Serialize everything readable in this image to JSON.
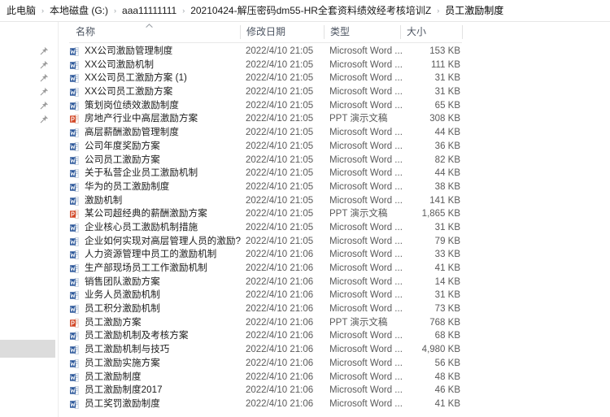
{
  "window": {
    "type": "file-explorer"
  },
  "breadcrumb": {
    "separator": "›",
    "items": [
      {
        "label": "此电脑"
      },
      {
        "label": "本地磁盘 (G:)"
      },
      {
        "label": "aaa11111111"
      },
      {
        "label": "20210424-解压密码dm55-HR全套资料绩效经考核培训Z"
      },
      {
        "label": "员工激励制度"
      }
    ]
  },
  "columns": {
    "name": "名称",
    "date_modified": "修改日期",
    "type": "类型",
    "size": "大小",
    "sort_column": "名称",
    "sort_direction": "ascending",
    "sort_icon": "chevron-up-icon"
  },
  "icons": {
    "word": "word-document-icon",
    "powerpoint": "powerpoint-document-icon",
    "pin": "pin-icon"
  },
  "types": {
    "word": "Microsoft Word ...",
    "powerpoint": "PPT 演示文稿"
  },
  "colors": {
    "word_blue": "#2b579a",
    "ppt_orange": "#d24726",
    "text": "#1b1b1b",
    "secondary_text": "#5a5a5a",
    "header_text": "#4d5562",
    "divider": "#e6e6e6"
  },
  "files": [
    {
      "name": "XX公司激励管理制度",
      "date": "2022/4/10 21:05",
      "type": "Microsoft Word ...",
      "size": "153 KB",
      "icon": "word",
      "pinned": true
    },
    {
      "name": "XX公司激励机制",
      "date": "2022/4/10 21:05",
      "type": "Microsoft Word ...",
      "size": "111 KB",
      "icon": "word",
      "pinned": true
    },
    {
      "name": "XX公司员工激励方案 (1)",
      "date": "2022/4/10 21:05",
      "type": "Microsoft Word ...",
      "size": "31 KB",
      "icon": "word",
      "pinned": true
    },
    {
      "name": "XX公司员工激励方案",
      "date": "2022/4/10 21:05",
      "type": "Microsoft Word ...",
      "size": "31 KB",
      "icon": "word",
      "pinned": true
    },
    {
      "name": "策划岗位绩效激励制度",
      "date": "2022/4/10 21:05",
      "type": "Microsoft Word ...",
      "size": "65 KB",
      "icon": "word",
      "pinned": true
    },
    {
      "name": "房地产行业中高层激励方案",
      "date": "2022/4/10 21:05",
      "type": "PPT 演示文稿",
      "size": "308 KB",
      "icon": "powerpoint",
      "pinned": true
    },
    {
      "name": "高层薪酬激励管理制度",
      "date": "2022/4/10 21:05",
      "type": "Microsoft Word ...",
      "size": "44 KB",
      "icon": "word",
      "pinned": false
    },
    {
      "name": "公司年度奖励方案",
      "date": "2022/4/10 21:05",
      "type": "Microsoft Word ...",
      "size": "36 KB",
      "icon": "word",
      "pinned": false
    },
    {
      "name": "公司员工激励方案",
      "date": "2022/4/10 21:05",
      "type": "Microsoft Word ...",
      "size": "82 KB",
      "icon": "word",
      "pinned": false
    },
    {
      "name": "关于私营企业员工激励机制",
      "date": "2022/4/10 21:05",
      "type": "Microsoft Word ...",
      "size": "44 KB",
      "icon": "word",
      "pinned": false
    },
    {
      "name": "华为的员工激励制度",
      "date": "2022/4/10 21:05",
      "type": "Microsoft Word ...",
      "size": "38 KB",
      "icon": "word",
      "pinned": false
    },
    {
      "name": "激励机制",
      "date": "2022/4/10 21:05",
      "type": "Microsoft Word ...",
      "size": "141 KB",
      "icon": "word",
      "pinned": false
    },
    {
      "name": "某公司超经典的薪酬激励方案",
      "date": "2022/4/10 21:05",
      "type": "PPT 演示文稿",
      "size": "1,865 KB",
      "icon": "powerpoint",
      "pinned": false
    },
    {
      "name": "企业核心员工激励机制措施",
      "date": "2022/4/10 21:05",
      "type": "Microsoft Word ...",
      "size": "31 KB",
      "icon": "word",
      "pinned": false
    },
    {
      "name": "企业如何实现对高层管理人员的激励?",
      "date": "2022/4/10 21:05",
      "type": "Microsoft Word ...",
      "size": "79 KB",
      "icon": "word",
      "pinned": false
    },
    {
      "name": "人力资源管理中员工的激励机制",
      "date": "2022/4/10 21:06",
      "type": "Microsoft Word ...",
      "size": "33 KB",
      "icon": "word",
      "pinned": false
    },
    {
      "name": "生产部现场员工工作激励机制",
      "date": "2022/4/10 21:06",
      "type": "Microsoft Word ...",
      "size": "41 KB",
      "icon": "word",
      "pinned": false
    },
    {
      "name": "销售团队激励方案",
      "date": "2022/4/10 21:06",
      "type": "Microsoft Word ...",
      "size": "14 KB",
      "icon": "word",
      "pinned": false
    },
    {
      "name": "业务人员激励机制",
      "date": "2022/4/10 21:06",
      "type": "Microsoft Word ...",
      "size": "31 KB",
      "icon": "word",
      "pinned": false
    },
    {
      "name": "员工积分激励机制",
      "date": "2022/4/10 21:06",
      "type": "Microsoft Word ...",
      "size": "73 KB",
      "icon": "word",
      "pinned": false
    },
    {
      "name": "员工激励方案",
      "date": "2022/4/10 21:06",
      "type": "PPT 演示文稿",
      "size": "768 KB",
      "icon": "powerpoint",
      "pinned": false
    },
    {
      "name": "员工激励机制及考核方案",
      "date": "2022/4/10 21:06",
      "type": "Microsoft Word ...",
      "size": "68 KB",
      "icon": "word",
      "pinned": false
    },
    {
      "name": "员工激励机制与技巧",
      "date": "2022/4/10 21:06",
      "type": "Microsoft Word ...",
      "size": "4,980 KB",
      "icon": "word",
      "pinned": false
    },
    {
      "name": "员工激励实施方案",
      "date": "2022/4/10 21:06",
      "type": "Microsoft Word ...",
      "size": "56 KB",
      "icon": "word",
      "pinned": false
    },
    {
      "name": "员工激励制度",
      "date": "2022/4/10 21:06",
      "type": "Microsoft Word ...",
      "size": "48 KB",
      "icon": "word",
      "pinned": false
    },
    {
      "name": "员工激励制度2017",
      "date": "2022/4/10 21:06",
      "type": "Microsoft Word ...",
      "size": "46 KB",
      "icon": "word",
      "pinned": false
    },
    {
      "name": "员工奖罚激励制度",
      "date": "2022/4/10 21:06",
      "type": "Microsoft Word ...",
      "size": "41 KB",
      "icon": "word",
      "pinned": false
    }
  ]
}
